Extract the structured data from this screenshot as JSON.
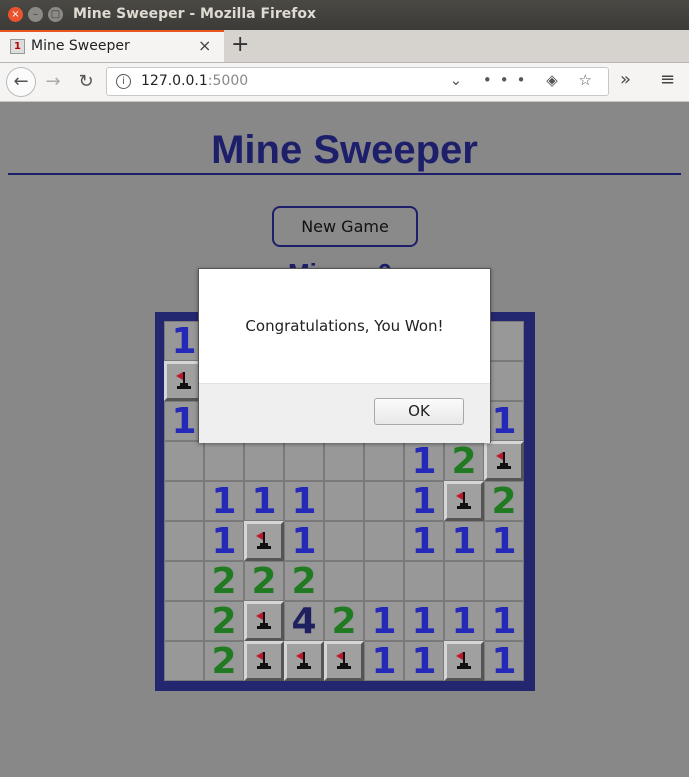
{
  "window": {
    "title": "Mine Sweeper - Mozilla Firefox"
  },
  "tab": {
    "label": "Mine Sweeper",
    "close": "×",
    "new_tab": "+"
  },
  "nav": {
    "url_host": "127.0.0.1",
    "url_port": ":5000",
    "page_actions": "⌄ ••• ◈ ☆"
  },
  "page": {
    "title": "Mine Sweeper",
    "new_game_label": "New Game",
    "mines_label": "Mines: 0"
  },
  "board": {
    "rows": [
      [
        "1",
        "",
        "",
        "",
        "",
        "",
        "",
        "",
        ""
      ],
      [
        "F",
        "",
        "",
        "",
        "",
        "",
        "",
        "",
        ""
      ],
      [
        "1",
        "",
        "",
        "",
        "",
        "",
        "",
        "",
        "1"
      ],
      [
        " ",
        " ",
        " ",
        " ",
        " ",
        " ",
        "1",
        "2",
        "F"
      ],
      [
        " ",
        "1",
        "1",
        "1",
        " ",
        " ",
        "1",
        "F",
        "2"
      ],
      [
        " ",
        "1",
        "F",
        "1",
        " ",
        " ",
        "1",
        "1",
        "1"
      ],
      [
        " ",
        "2",
        "2",
        "2",
        " ",
        " ",
        " ",
        " ",
        " "
      ],
      [
        " ",
        "2",
        "F",
        "4",
        "2",
        "1",
        "1",
        "1",
        "1"
      ],
      [
        " ",
        "2",
        "F",
        "F",
        "F",
        "1",
        "1",
        "F",
        "1"
      ]
    ]
  },
  "dialog": {
    "message": "Congratulations, You Won!",
    "ok_label": "OK"
  },
  "colors": {
    "accent": "#1e1f6b",
    "one": "#2429b8",
    "two": "#1f7a22",
    "four": "#1f2060"
  }
}
